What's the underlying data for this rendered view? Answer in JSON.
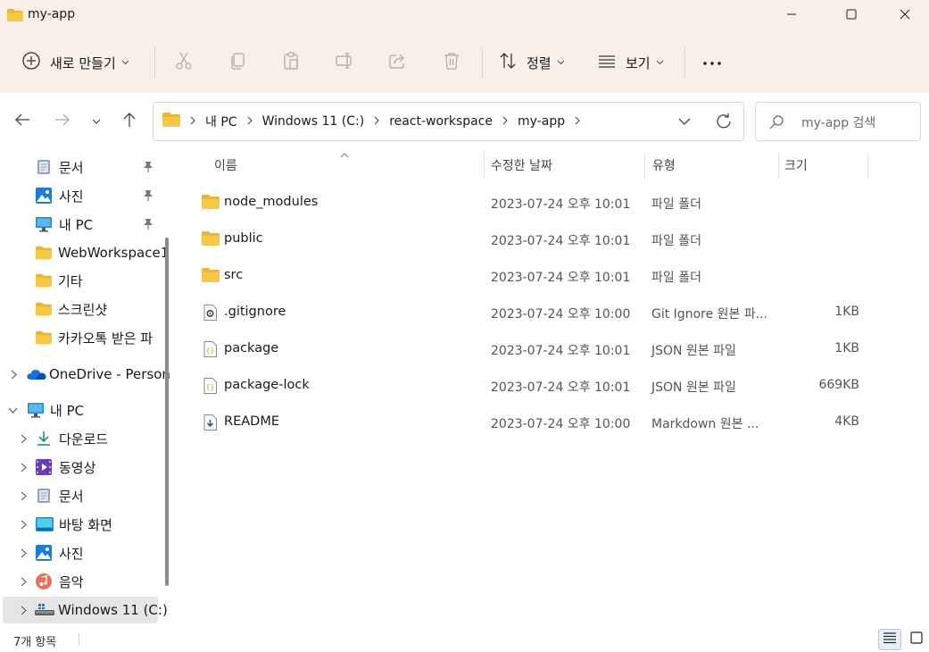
{
  "window": {
    "title": "my-app",
    "minimize_icon": "minimize-icon",
    "maximize_icon": "maximize-icon",
    "close_icon": "close-icon"
  },
  "toolbar": {
    "new_label": "새로 만들기",
    "sort_label": "정렬",
    "view_label": "보기",
    "more_label": "···",
    "icons": [
      "plus-circle-icon",
      "cut-icon",
      "copy-icon",
      "paste-icon",
      "rename-icon",
      "share-icon",
      "delete-icon",
      "sort-icon",
      "view-list-icon",
      "more-icon"
    ]
  },
  "address": {
    "crumbs": [
      "내 PC",
      "Windows 11 (C:)",
      "react-workspace",
      "my-app"
    ],
    "search_placeholder": "my-app 검색"
  },
  "sidebar": {
    "items": [
      {
        "label": "문서",
        "icon": "document-icon",
        "pinned": true,
        "indent": 0,
        "expandable": false
      },
      {
        "label": "사진",
        "icon": "pictures-icon",
        "pinned": true,
        "indent": 0,
        "expandable": false
      },
      {
        "label": "내 PC",
        "icon": "monitor-icon",
        "pinned": true,
        "indent": 0,
        "expandable": false
      },
      {
        "label": "WebWorkspace1",
        "icon": "folder-icon",
        "pinned": false,
        "indent": 0,
        "expandable": false
      },
      {
        "label": "기타",
        "icon": "folder-icon",
        "pinned": false,
        "indent": 0,
        "expandable": false
      },
      {
        "label": "스크린샷",
        "icon": "folder-icon",
        "pinned": false,
        "indent": 0,
        "expandable": false
      },
      {
        "label": "카카오톡 받은 파",
        "icon": "folder-icon",
        "pinned": false,
        "indent": 0,
        "expandable": false
      },
      {
        "label": "OneDrive - Person",
        "icon": "onedrive-icon",
        "pinned": false,
        "indent": 0,
        "expandable": true,
        "expanded": false
      },
      {
        "label": "내 PC",
        "icon": "monitor-icon",
        "pinned": false,
        "indent": 0,
        "expandable": true,
        "expanded": true
      },
      {
        "label": "다운로드",
        "icon": "download-icon",
        "pinned": false,
        "indent": 1,
        "expandable": true,
        "expanded": false
      },
      {
        "label": "동영상",
        "icon": "video-icon",
        "pinned": false,
        "indent": 1,
        "expandable": true,
        "expanded": false
      },
      {
        "label": "문서",
        "icon": "document-icon",
        "pinned": false,
        "indent": 1,
        "expandable": true,
        "expanded": false
      },
      {
        "label": "바탕 화면",
        "icon": "desktop-icon",
        "pinned": false,
        "indent": 1,
        "expandable": true,
        "expanded": false
      },
      {
        "label": "사진",
        "icon": "pictures-icon",
        "pinned": false,
        "indent": 1,
        "expandable": true,
        "expanded": false
      },
      {
        "label": "음악",
        "icon": "music-icon",
        "pinned": false,
        "indent": 1,
        "expandable": true,
        "expanded": false
      },
      {
        "label": "Windows 11 (C:)",
        "icon": "drive-icon",
        "pinned": false,
        "indent": 1,
        "expandable": true,
        "expanded": false,
        "selected": true
      }
    ]
  },
  "columns": {
    "name": "이름",
    "date": "수정한 날짜",
    "type": "유형",
    "size": "크기"
  },
  "files": [
    {
      "name": "node_modules",
      "date": "2023-07-24 오후 10:01",
      "type": "파일 폴더",
      "size": "",
      "icon": "folder-icon"
    },
    {
      "name": "public",
      "date": "2023-07-24 오후 10:01",
      "type": "파일 폴더",
      "size": "",
      "icon": "folder-icon"
    },
    {
      "name": "src",
      "date": "2023-07-24 오후 10:01",
      "type": "파일 폴더",
      "size": "",
      "icon": "folder-icon"
    },
    {
      "name": ".gitignore",
      "date": "2023-07-24 오후 10:00",
      "type": "Git Ignore 원본 파...",
      "size": "1KB",
      "icon": "gear-file-icon"
    },
    {
      "name": "package",
      "date": "2023-07-24 오후 10:01",
      "type": "JSON 원본 파일",
      "size": "1KB",
      "icon": "json-file-icon"
    },
    {
      "name": "package-lock",
      "date": "2023-07-24 오후 10:01",
      "type": "JSON 원본 파일",
      "size": "669KB",
      "icon": "json-file-icon"
    },
    {
      "name": "README",
      "date": "2023-07-24 오후 10:00",
      "type": "Markdown 원본 ...",
      "size": "4KB",
      "icon": "markdown-file-icon"
    }
  ],
  "status": {
    "count": "7개 항목"
  },
  "colors": {
    "chrome_bg": "#f8efe9",
    "folder": "#f6c944",
    "selected_bg": "#e5e5e5",
    "accent": "#0067c0"
  }
}
